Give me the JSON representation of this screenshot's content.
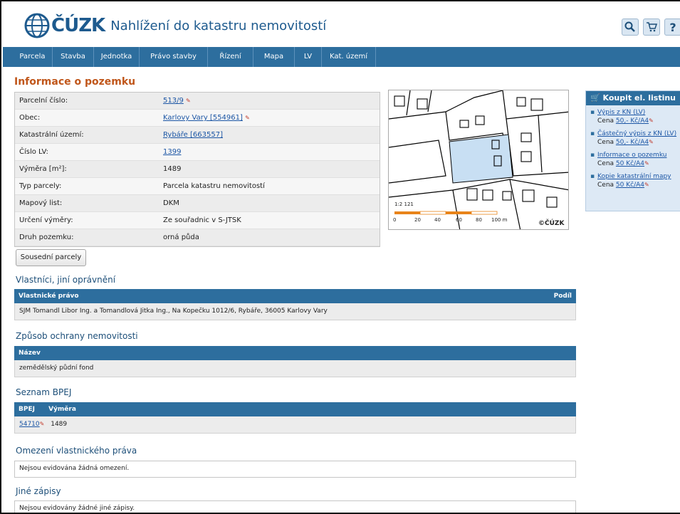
{
  "header": {
    "logo_text": "ČÚZK",
    "subtitle": "Nahlížení do katastru nemovitostí",
    "icons": [
      "search-icon",
      "cart-icon",
      "help-icon"
    ]
  },
  "nav": {
    "items": [
      {
        "label": "Parcela"
      },
      {
        "label": "Stavba"
      },
      {
        "label": "Jednotka"
      },
      {
        "label": "Právo stavby"
      },
      {
        "label": "Řízení"
      },
      {
        "label": "Mapa"
      },
      {
        "label": "LV"
      },
      {
        "label": "Kat. území"
      }
    ]
  },
  "parcel": {
    "title": "Informace o pozemku",
    "rows": [
      {
        "label": "Parcelní číslo:",
        "value": "513/9",
        "link": true
      },
      {
        "label": "Obec:",
        "value": "Karlovy Vary [554961]",
        "link": true
      },
      {
        "label": "Katastrální území:",
        "value": "Rybáře [663557]",
        "link": true
      },
      {
        "label": "Číslo LV:",
        "value": "1399",
        "link": true
      },
      {
        "label": "Výměra [m²]:",
        "value": "1489",
        "link": false
      },
      {
        "label": "Typ parcely:",
        "value": "Parcela katastru nemovitostí",
        "link": false
      },
      {
        "label": "Mapový list:",
        "value": "DKM",
        "link": false
      },
      {
        "label": "Určení výměry:",
        "value": "Ze souřadnic v S-JTSK",
        "link": false
      },
      {
        "label": "Druh pozemku:",
        "value": "orná půda",
        "link": false
      }
    ]
  },
  "map": {
    "scale_label": "1:2 121",
    "ticks": [
      "0",
      "20",
      "40",
      "60",
      "80",
      "100 m"
    ],
    "copyright": "©ČÚZK"
  },
  "neighbors_button": "Sousední parcely",
  "owners": {
    "title": "Vlastníci, jiní oprávnění",
    "col_left": "Vlastnické právo",
    "col_right": "Podíl",
    "row": "SJM Tomandl Libor Ing. a Tomandlová Jitka Ing., Na Kopečku 1012/6, Rybáře, 36005 Karlovy Vary"
  },
  "protection": {
    "title": "Způsob ochrany nemovitosti",
    "col": "Název",
    "row": "zemědělský půdní fond"
  },
  "bpej": {
    "title": "Seznam BPEJ",
    "col1": "BPEJ",
    "col2": "Výměra",
    "code": "54710",
    "area": "1489"
  },
  "restriction": {
    "title": "Omezení vlastnického práva",
    "text": "Nejsou evidována žádná omezení."
  },
  "other": {
    "title": "Jiné zápisy",
    "text": "Nejsou evidovány žádné jiné zápisy."
  },
  "sidebar": {
    "title": "Koupit el. listinu",
    "items": [
      {
        "link": "Výpis z KN (LV)",
        "price_prefix": "Cena ",
        "price": "50,- Kč/A4"
      },
      {
        "link": "Částečný výpis z KN (LV)",
        "price_prefix": "Cena ",
        "price": "50,- Kč/A4"
      },
      {
        "link": "Informace o pozemku",
        "price_prefix": "Cena ",
        "price": "50 Kč/A4"
      },
      {
        "link": "Kopie katastrální mapy",
        "price_prefix": "Cena ",
        "price": "50 Kč/A4"
      }
    ]
  }
}
